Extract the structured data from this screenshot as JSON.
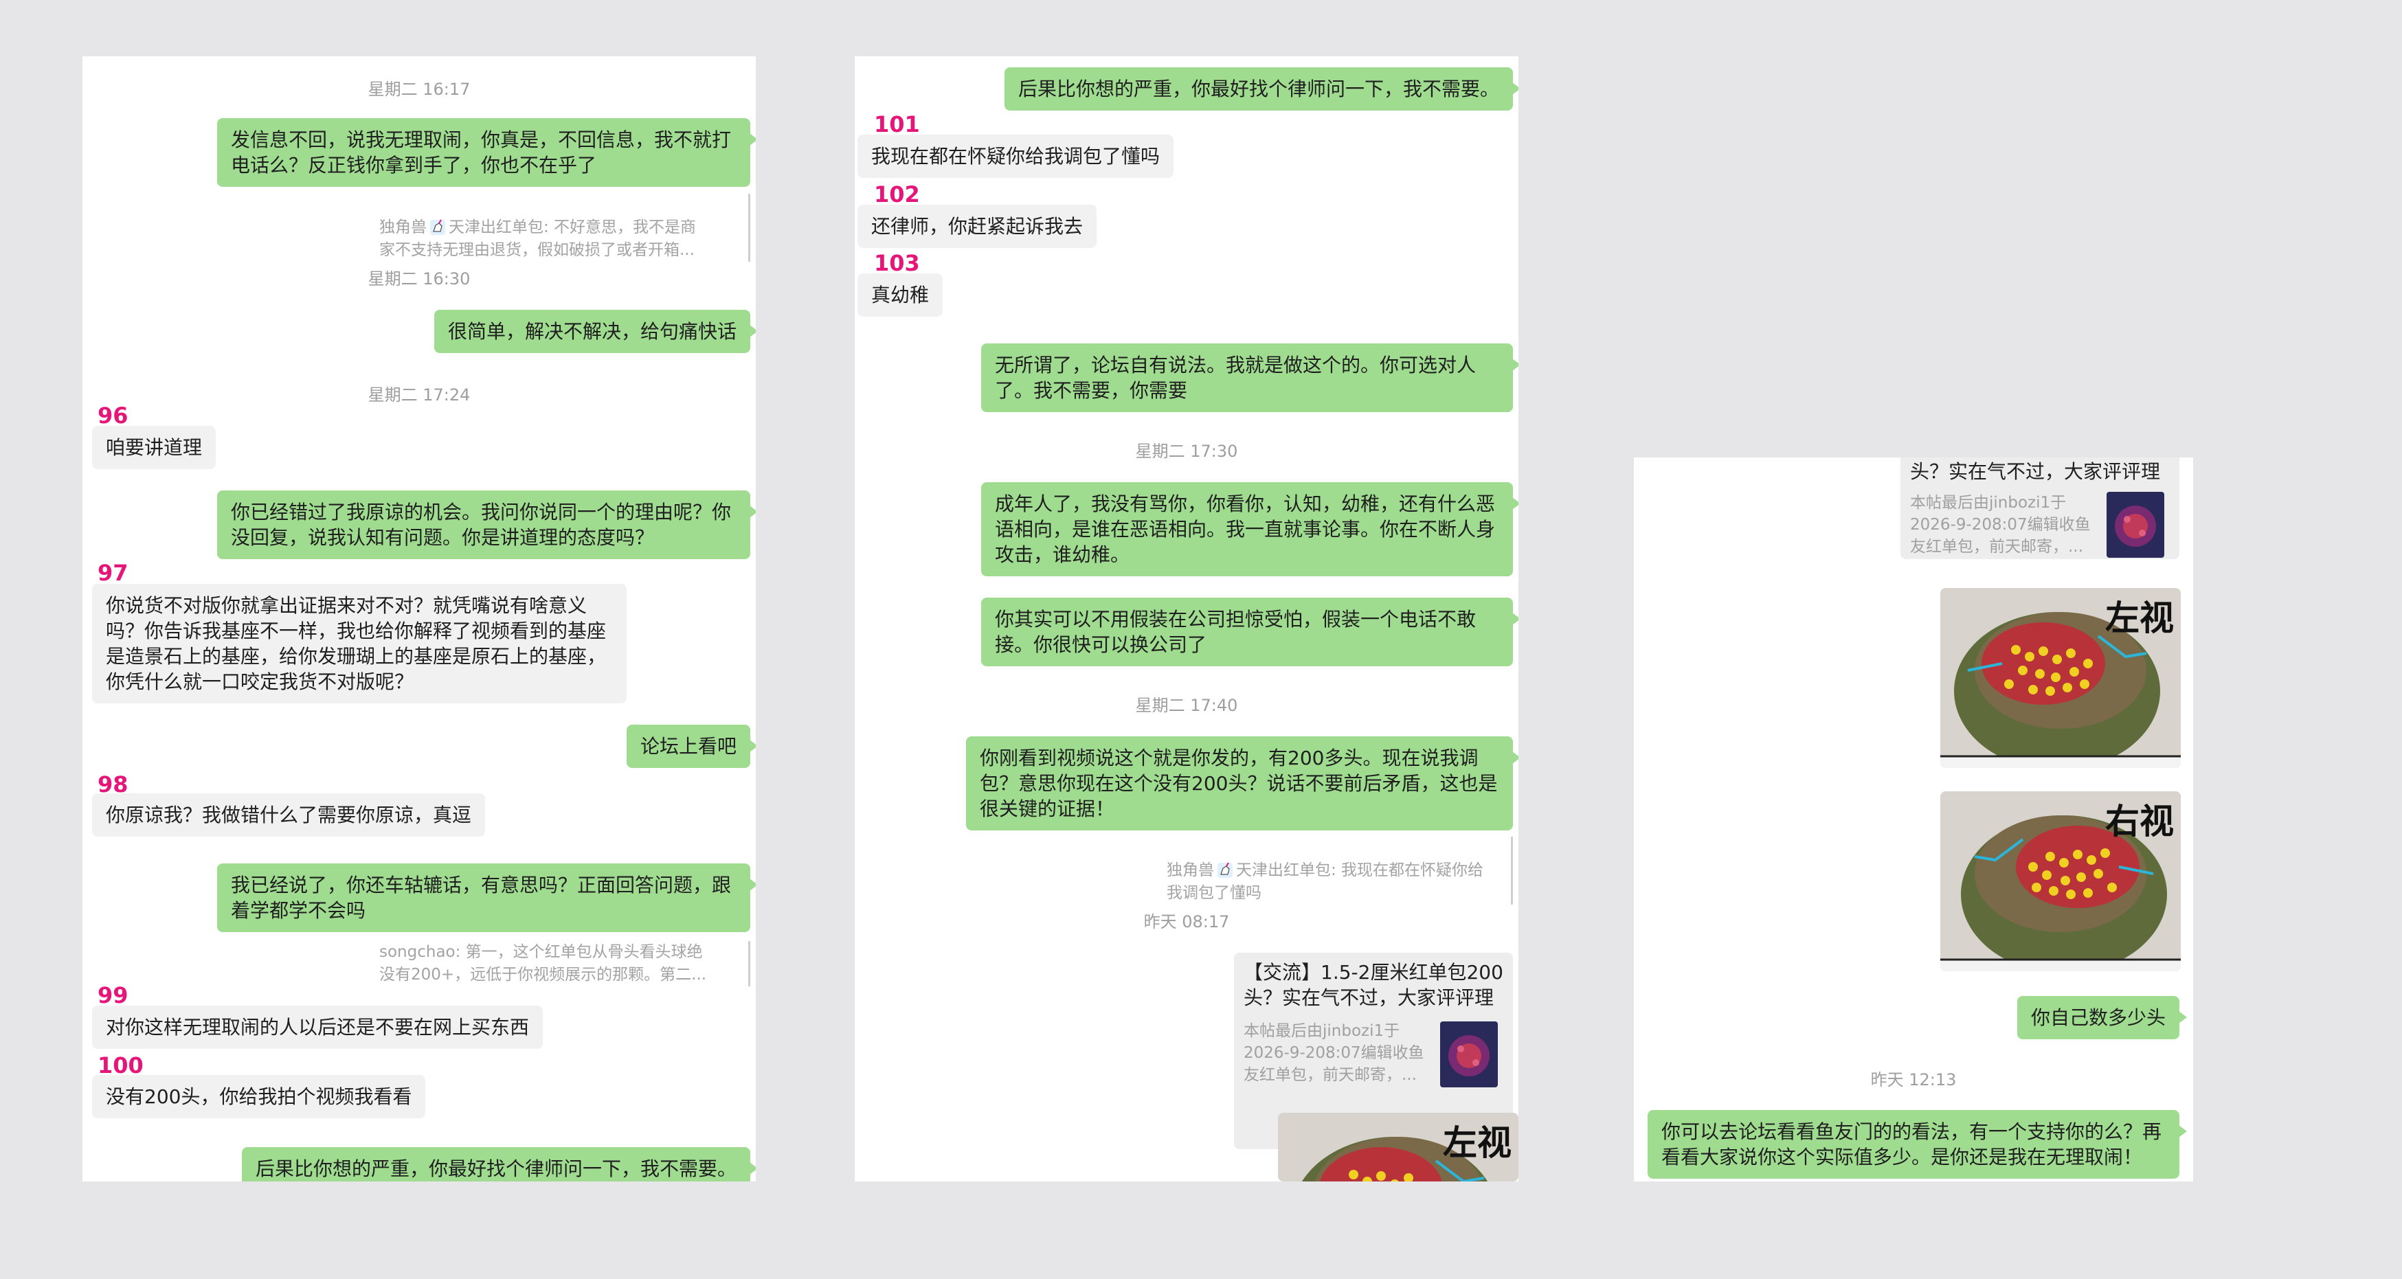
{
  "panel1": {
    "ts1": "星期二 16:17",
    "msg1": "发信息不回，说我无理取闹，你真是，不回信息，我不就打电话么？反正钱你拿到手了，你也不在乎了",
    "quote1_author": "独角兽",
    "quote1_text": "天津出红单包: 不好意思，我不是商\n家不支持无理由退货，假如破损了或者开箱...",
    "ts2": "星期二 16:30",
    "msg2": "很简单，解决不解决，给句痛快话",
    "ts3": "星期二 17:24",
    "n96": "96",
    "msg96": "咱要讲道理",
    "msg3": "你已经错过了我原谅的机会。我问你说同一个的理由呢？你没回复，说我认知有问题。你是讲道理的态度吗？",
    "n97": "97",
    "msg97": "你说货不对版你就拿出证据来对不对？就凭嘴说有啥意义吗？你告诉我基座不一样，我也给你解释了视频看到的基座是造景石上的基座，给你发珊瑚上的基座是原石上的基座，你凭什么就一口咬定我货不对版呢？",
    "msg4": "论坛上看吧",
    "n98": "98",
    "msg98": "你原谅我？我做错什么了需要你原谅，真逗",
    "msg5": "我已经说了，你还车轱辘话，有意思吗？正面回答问题，跟着学都学不会吗",
    "quote2": "songchao: 第一，这个红单包从骨头看头球绝\n没有200+，远低于你视频展示的那颗。第二...",
    "n99": "99",
    "msg99": "对你这样无理取闹的人以后还是不要在网上买东西",
    "n100": "100",
    "msg100": "没有200头，你给我拍个视频我看看",
    "msg6": "后果比你想的严重，你最好找个律师问一下，我不需要。"
  },
  "panel2": {
    "msg1": "后果比你想的严重，你最好找个律师问一下，我不需要。",
    "n101": "101",
    "msg101": "我现在都在怀疑你给我调包了懂吗",
    "n102": "102",
    "msg102": "还律师，你赶紧起诉我去",
    "n103": "103",
    "msg103": "真幼稚",
    "msg2": "无所谓了，论坛自有说法。我就是做这个的。你可选对人了。我不需要，你需要",
    "ts1": "星期二 17:30",
    "msg3": "成年人了，我没有骂你，你看你，认知，幼稚，还有什么恶语相向，是谁在恶语相向。我一直就事论事。你在不断人身攻击，谁幼稚。",
    "msg4": "你其实可以不用假装在公司担惊受怕，假装一个电话不敢接。你很快可以换公司了",
    "ts2": "星期二 17:40",
    "msg5": "你刚看到视频说这个就是你发的，有200多头。现在说我调包？意思你现在这个没有200头？说话不要前后矛盾，这也是很关键的证据！",
    "quote1_author": "独角兽",
    "quote1_text": "天津出红单包: 我现在都在怀疑你给\n我调包了懂吗",
    "ts3": "昨天 08:17",
    "link_title": "【交流】1.5-2厘米红单包200\n头？实在气不过，大家评评理",
    "link_desc": "本帖最后由jinbozi1于\n2026-9-208:07编辑收鱼\n友红单包，前天邮寄，...",
    "photo_caption": "左视"
  },
  "panel3": {
    "link_title": "头？实在气不过，大家评评理",
    "link_desc": "本帖最后由jinbozi1于\n2026-9-208:07编辑收鱼\n友红单包，前天邮寄，...",
    "photo1_caption": "左视",
    "photo2_caption": "右视",
    "msg1": "你自己数多少头",
    "ts1": "昨天 12:13",
    "msg2": "你可以去论坛看看鱼友门的的看法，有一个支持你的么？再看看大家说你这个实际值多少。是你还是我在无理取闹！"
  },
  "colors": {
    "my_bubble": "#9fdc90",
    "other_bubble": "#f1f1f1",
    "number": "#e5157a",
    "timestamp": "#9e9e9e",
    "background": "#e6e6e8"
  }
}
